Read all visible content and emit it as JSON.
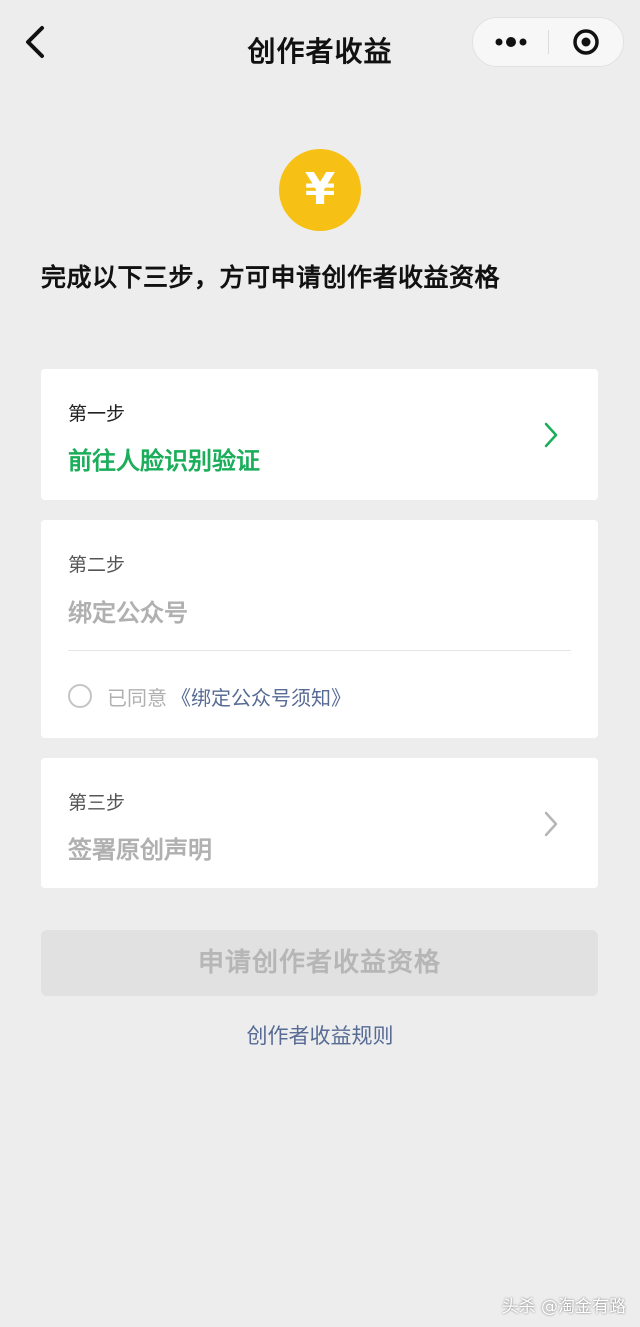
{
  "nav": {
    "title": "创作者收益",
    "back_icon": "chevron-left-icon",
    "more_icon": "more-dots-icon",
    "close_icon": "target-close-icon"
  },
  "coin": {
    "symbol": "¥",
    "color": "#f7c014"
  },
  "headline": "完成以下三步，方可申请创作者收益资格",
  "steps": [
    {
      "label": "第一步",
      "title": "前往人脸识别验证",
      "state": "active",
      "title_color": "#1aad5a"
    },
    {
      "label": "第二步",
      "title": "绑定公众号",
      "state": "disabled",
      "agree_text": "已同意",
      "agree_link": "《绑定公众号须知》",
      "agree_checked": false
    },
    {
      "label": "第三步",
      "title": "签署原创声明",
      "state": "disabled"
    }
  ],
  "apply_button": {
    "label": "申请创作者收益资格",
    "enabled": false
  },
  "rules_link": "创作者收益规则",
  "watermark": "头杀 @淘金有路",
  "colors": {
    "background": "#ededed",
    "link": "#576b95",
    "disabled_text": "#b0b0b0"
  }
}
